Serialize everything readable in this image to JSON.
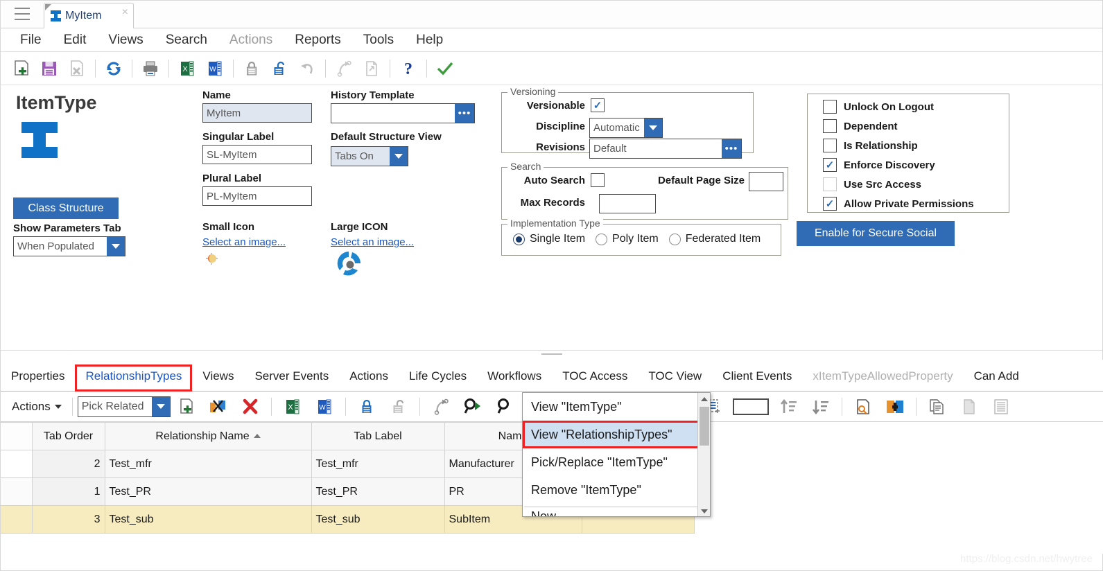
{
  "window": {
    "tab_title": "MyItem",
    "tab_close_label": "×",
    "hamburger_name": "menu"
  },
  "menubar": {
    "items": [
      {
        "label": "File",
        "dim": false
      },
      {
        "label": "Edit",
        "dim": false
      },
      {
        "label": "Views",
        "dim": false
      },
      {
        "label": "Search",
        "dim": false
      },
      {
        "label": "Actions",
        "dim": true
      },
      {
        "label": "Reports",
        "dim": false
      },
      {
        "label": "Tools",
        "dim": false
      },
      {
        "label": "Help",
        "dim": false
      }
    ]
  },
  "toolbar": {
    "buttons": [
      {
        "name": "new-icon"
      },
      {
        "name": "save-icon"
      },
      {
        "name": "delete-icon"
      },
      {
        "sep": true
      },
      {
        "name": "refresh-icon"
      },
      {
        "sep": true
      },
      {
        "name": "print-icon"
      },
      {
        "sep": true
      },
      {
        "name": "export-excel-icon"
      },
      {
        "name": "export-word-icon"
      },
      {
        "sep": true
      },
      {
        "name": "lock-icon"
      },
      {
        "name": "unlock-icon"
      },
      {
        "name": "undo-icon"
      },
      {
        "sep": true
      },
      {
        "name": "redo-icon"
      },
      {
        "name": "copy-page-icon"
      },
      {
        "sep": true
      },
      {
        "name": "help-icon"
      },
      {
        "sep": true
      },
      {
        "name": "done-check-icon"
      }
    ]
  },
  "form": {
    "itemtype_heading": "ItemType",
    "class_structure_button": "Class Structure",
    "show_parameters_tab_label": "Show Parameters Tab",
    "show_parameters_tab_value": "When Populated",
    "name_label": "Name",
    "name_value": "MyItem",
    "singular_label_label": "Singular Label",
    "singular_label_value": "SL-MyItem",
    "plural_label_label": "Plural Label",
    "plural_label_value": "PL-MyItem",
    "small_icon_label": "Small Icon",
    "small_icon_link": "Select an image...",
    "large_icon_label": "Large ICON",
    "large_icon_link": "Select an image...",
    "history_template_label": "History Template",
    "history_template_value": "",
    "default_structure_view_label": "Default Structure View",
    "default_structure_view_value": "Tabs On",
    "ellipsis_label": "•••"
  },
  "versioning": {
    "legend": "Versioning",
    "versionable_label": "Versionable",
    "versionable_checked": true,
    "discipline_label": "Discipline",
    "discipline_value": "Automatic",
    "revisions_label": "Revisions",
    "revisions_value": "Default"
  },
  "search_group": {
    "legend": "Search",
    "auto_search_label": "Auto Search",
    "auto_search_checked": false,
    "default_page_size_label": "Default Page Size",
    "default_page_size_value": "",
    "max_records_label": "Max Records",
    "max_records_value": ""
  },
  "implementation": {
    "legend": "Implementation Type",
    "options": [
      {
        "label": "Single Item",
        "selected": true
      },
      {
        "label": "Poly Item",
        "selected": false
      },
      {
        "label": "Federated Item",
        "selected": false
      }
    ]
  },
  "flags": {
    "items": [
      {
        "label": "Unlock On Logout",
        "checked": false
      },
      {
        "label": "Dependent",
        "checked": false
      },
      {
        "label": "Is Relationship",
        "checked": false
      },
      {
        "label": "Enforce Discovery",
        "checked": true
      },
      {
        "label": "Use Src Access",
        "checked": false
      },
      {
        "label": "Allow Private Permissions",
        "checked": true
      }
    ],
    "secure_social_button": "Enable for Secure Social"
  },
  "tabs": {
    "items": [
      {
        "label": "Properties",
        "state": "normal"
      },
      {
        "label": "RelationshipTypes",
        "state": "active"
      },
      {
        "label": "Views",
        "state": "normal"
      },
      {
        "label": "Server Events",
        "state": "normal"
      },
      {
        "label": "Actions",
        "state": "normal"
      },
      {
        "label": "Life Cycles",
        "state": "normal"
      },
      {
        "label": "Workflows",
        "state": "normal"
      },
      {
        "label": "TOC Access",
        "state": "normal"
      },
      {
        "label": "TOC View",
        "state": "normal"
      },
      {
        "label": "Client Events",
        "state": "normal"
      },
      {
        "label": "xItemTypeAllowedProperty",
        "state": "dim"
      },
      {
        "label": "Can Add",
        "state": "normal"
      }
    ]
  },
  "toolbar2": {
    "actions_label": "Actions",
    "pick_related_value": "Pick Related",
    "buttons": [
      {
        "name": "new-relationship-icon"
      },
      {
        "name": "pick-related-item-icon"
      },
      {
        "name": "delete-red-x-icon"
      },
      {
        "sep": true
      },
      {
        "name": "export-excel-icon"
      },
      {
        "name": "export-word-icon"
      },
      {
        "sep": true
      },
      {
        "name": "lock-icon"
      },
      {
        "name": "unlock-icon"
      },
      {
        "sep": true
      },
      {
        "name": "redo-icon"
      },
      {
        "name": "search-run-icon"
      },
      {
        "name": "search-dropdown-icon"
      },
      {
        "sep": true
      },
      {
        "name": "select-all-rows-icon"
      },
      {
        "name": "blank-box-icon"
      },
      {
        "name": "sort-ascending-icon"
      },
      {
        "name": "sort-descending-icon"
      },
      {
        "sep": true
      },
      {
        "name": "find-in-page-icon"
      },
      {
        "name": "add-colored-icon"
      },
      {
        "sep": true
      },
      {
        "name": "copy-icon"
      },
      {
        "name": "paste-icon"
      },
      {
        "name": "list-icon"
      }
    ]
  },
  "dropdown_menu": {
    "items": [
      {
        "label": "View \"ItemType\"",
        "highlighted": false
      },
      {
        "label": "View \"RelationshipTypes\"",
        "highlighted": true
      },
      {
        "label": "Pick/Replace \"ItemType\"",
        "highlighted": false
      },
      {
        "label": "Remove \"ItemType\"",
        "highlighted": false
      },
      {
        "label": "New",
        "highlighted": false
      }
    ]
  },
  "grid": {
    "columns": [
      "Tab Order",
      "Relationship Name",
      "Tab Label",
      "Name",
      ""
    ],
    "sorted_column_index": 1,
    "sort_direction": "asc",
    "rows": [
      {
        "tab_order": "2",
        "relationship_name": "Test_mfr",
        "tab_label": "Test_mfr",
        "name": "Manufacturer",
        "extra": "",
        "selected": false
      },
      {
        "tab_order": "1",
        "relationship_name": "Test_PR",
        "tab_label": "Test_PR",
        "name": "PR",
        "extra": "",
        "selected": false
      },
      {
        "tab_order": "3",
        "relationship_name": "Test_sub",
        "tab_label": "Test_sub",
        "name": "SubItem",
        "extra": "",
        "selected": true
      }
    ]
  },
  "watermark": "https://blog.csdn.net/hwytree",
  "colors": {
    "accent_blue": "#2f6cb5",
    "link_blue": "#1a56c4",
    "highlight_red": "#ee2222",
    "selected_row": "#f7ebc0",
    "menu_highlight": "#cfe0f2"
  }
}
